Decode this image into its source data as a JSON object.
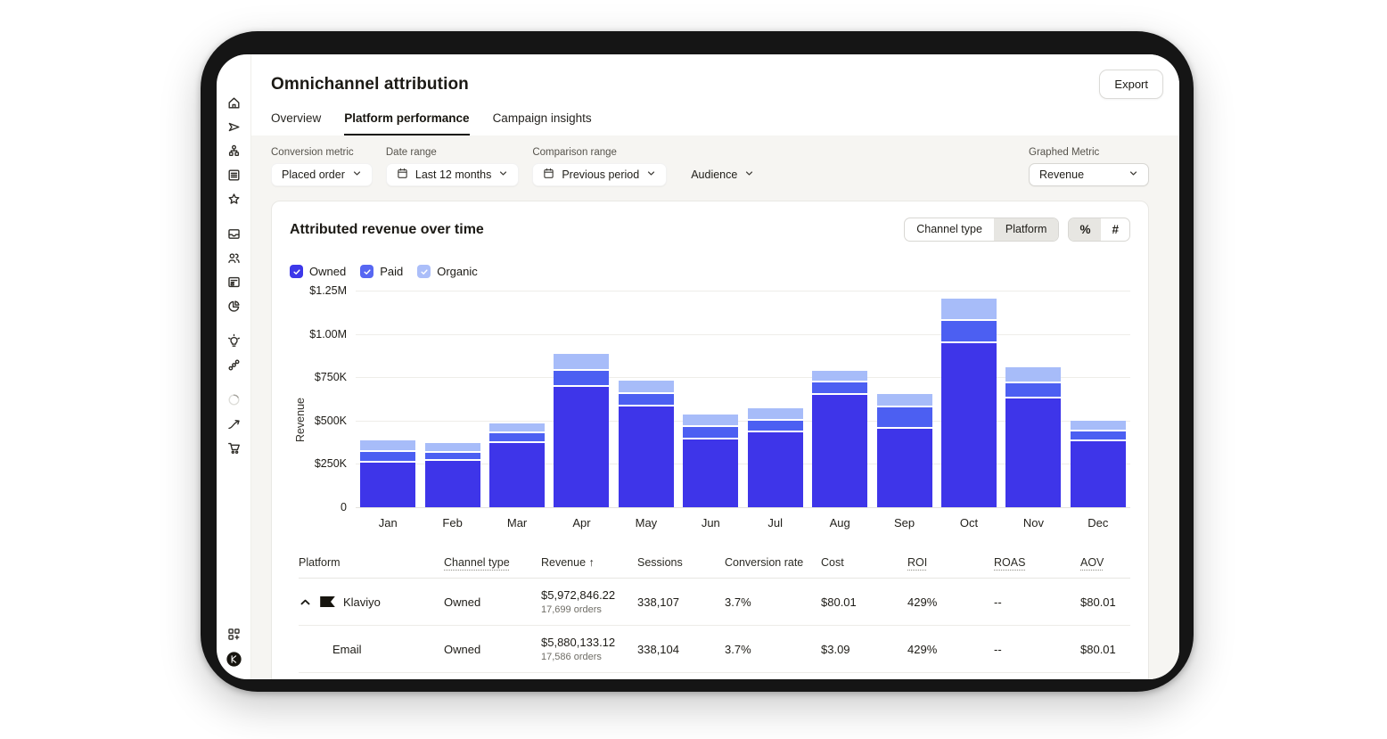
{
  "header": {
    "title": "Omnichannel attribution",
    "export_label": "Export"
  },
  "tabs": [
    {
      "label": "Overview",
      "active": false
    },
    {
      "label": "Platform performance",
      "active": true
    },
    {
      "label": "Campaign insights",
      "active": false
    }
  ],
  "filters": {
    "conversion_metric_label": "Conversion metric",
    "conversion_metric_value": "Placed order",
    "date_range_label": "Date range",
    "date_range_value": "Last 12 months",
    "comparison_range_label": "Comparison range",
    "comparison_range_value": "Previous period",
    "audience_label": "Audience",
    "graphed_metric_label": "Graphed Metric",
    "graphed_metric_value": "Revenue"
  },
  "card": {
    "title": "Attributed revenue over time",
    "view_toggle": {
      "options": [
        "Channel type",
        "Platform"
      ],
      "selected": "Platform"
    },
    "format_toggle": {
      "options": [
        "%",
        "#"
      ],
      "selected": "%"
    }
  },
  "legend": [
    {
      "label": "Owned",
      "color": "#3d38e9",
      "checked": true
    },
    {
      "label": "Paid",
      "color": "#5767f2",
      "checked": true
    },
    {
      "label": "Organic",
      "color": "#abbef9",
      "checked": true
    }
  ],
  "chart_data": {
    "type": "bar",
    "stacked": true,
    "title": "Attributed revenue over time",
    "xlabel": "",
    "ylabel": "Revenue",
    "unit": "thousand USD",
    "ylim": [
      0,
      1250
    ],
    "grid": true,
    "legend_position": "top-left",
    "yticks": [
      {
        "label": "$1.25M",
        "value": 1250
      },
      {
        "label": "$1.00M",
        "value": 1000
      },
      {
        "label": "$750K",
        "value": 750
      },
      {
        "label": "$500K",
        "value": 500
      },
      {
        "label": "$250K",
        "value": 250
      },
      {
        "label": "0",
        "value": 0
      }
    ],
    "categories": [
      "Jan",
      "Feb",
      "Mar",
      "Apr",
      "May",
      "Jun",
      "Jul",
      "Aug",
      "Sep",
      "Oct",
      "Nov",
      "Dec"
    ],
    "series": [
      {
        "name": "Owned",
        "color": "#3e35e9",
        "values": [
          258,
          265,
          368,
          696,
          580,
          390,
          434,
          648,
          454,
          945,
          626,
          382
        ]
      },
      {
        "name": "Paid",
        "color": "#4c5ff2",
        "values": [
          50,
          35,
          46,
          80,
          63,
          60,
          55,
          60,
          112,
          118,
          77,
          46
        ]
      },
      {
        "name": "Organic",
        "color": "#a7bcf9",
        "values": [
          58,
          45,
          44,
          86,
          65,
          60,
          60,
          57,
          65,
          117,
          82,
          52
        ]
      }
    ]
  },
  "table": {
    "headers": [
      {
        "label": "Platform",
        "dotted": false,
        "sort": ""
      },
      {
        "label": "Channel type",
        "dotted": true,
        "sort": ""
      },
      {
        "label": "Revenue",
        "dotted": false,
        "sort": "↑"
      },
      {
        "label": "Sessions",
        "dotted": false,
        "sort": ""
      },
      {
        "label": "Conversion rate",
        "dotted": false,
        "sort": ""
      },
      {
        "label": "Cost",
        "dotted": false,
        "sort": ""
      },
      {
        "label": "ROI",
        "dotted": true,
        "sort": ""
      },
      {
        "label": "ROAS",
        "dotted": true,
        "sort": ""
      },
      {
        "label": "AOV",
        "dotted": true,
        "sort": ""
      }
    ],
    "rows": [
      {
        "expander": true,
        "icon": "klaviyo-flag",
        "platform": "Klaviyo",
        "channel_type": "Owned",
        "revenue": "$5,972,846.22",
        "orders": "17,699 orders",
        "sessions": "338,107",
        "conversion_rate": "3.7%",
        "cost": "$80.01",
        "roi": "429%",
        "roas": "--",
        "aov": "$80.01",
        "indent": false
      },
      {
        "expander": false,
        "icon": "",
        "platform": "Email",
        "channel_type": "Owned",
        "revenue": "$5,880,133.12",
        "orders": "17,586 orders",
        "sessions": "338,104",
        "conversion_rate": "3.7%",
        "cost": "$3.09",
        "roi": "429%",
        "roas": "--",
        "aov": "$80.01",
        "indent": true
      }
    ]
  },
  "sidebar": {
    "groups": [
      [
        "home-icon",
        "send-icon",
        "flow-icon",
        "list-icon",
        "star-icon"
      ],
      [
        "tray-icon",
        "users-icon",
        "news-icon",
        "pie-icon"
      ],
      [
        "bulb-icon",
        "links-icon"
      ],
      [
        "spinner-icon",
        "trend-icon",
        "cart-icon"
      ]
    ],
    "bottom": [
      "apps-icon",
      "klaviyo-badge-icon"
    ]
  }
}
